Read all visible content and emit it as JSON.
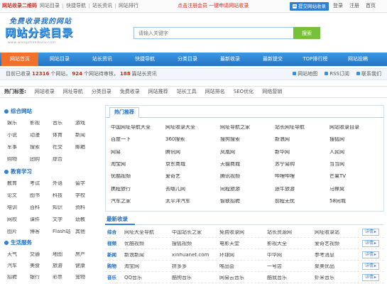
{
  "topbar": {
    "brand": "网站收录二维码",
    "links": [
      "网站目录",
      "快捷导航",
      "站长资讯",
      "网站排行"
    ],
    "notice": "点击注册会员 一键申请网站收录",
    "submit_label": "提交网站收录",
    "right_links": [
      "登录",
      "注册",
      "首页"
    ]
  },
  "header": {
    "logo_top": "免费收录我的网站",
    "logo_main": "网站分类目录",
    "logo_sub": "www.wangzhanmulu.com",
    "search": {
      "placeholder": "请输入关键字",
      "button": "搜索"
    }
  },
  "nav": {
    "items": [
      "网站首页",
      "网站目录",
      "站长资讯",
      "快捷导航",
      "分类目录",
      "最新收录",
      "最新提交",
      "TOP排行榜",
      "网站投稿"
    ]
  },
  "stats": {
    "prefix": "目前已收录",
    "n1": "12316",
    "t1": "个网站，",
    "n2": "924",
    "t2": "个网站待审核，",
    "n3": "188",
    "t3": "篇站长资讯",
    "right_links": [
      "网站地图",
      "RSS订阅",
      "联系我们"
    ]
  },
  "tags": {
    "label": "热门标签:",
    "items": [
      "网站收录",
      "网址导航",
      "分类目录",
      "免费收录",
      "网站推荐",
      "站长工具",
      "网站排名",
      "SEO优化",
      "网络营销"
    ]
  },
  "sidebar": {
    "groups": [
      {
        "title": "综合网站",
        "items": [
          "娱乐",
          "影视",
          "音乐",
          "游戏",
          "小说",
          "动漫",
          "体育",
          "新闻",
          "军事",
          "搜索",
          "社交",
          "邮箱",
          "购物",
          "团购",
          "综合"
        ]
      },
      {
        "title": "教育学习",
        "items": [
          "教育",
          "考试",
          "外语",
          "留学",
          "论文",
          "图书",
          "科技",
          "学校",
          "培训",
          "百科",
          "知识",
          "资料",
          "网校",
          "课件",
          "文学",
          "幼教",
          "图片",
          "博客",
          "Flash站",
          "其他"
        ]
      },
      {
        "title": "生活服务",
        "items": [
          "天气",
          "交通",
          "地图",
          "房产",
          "汽车",
          "美食",
          "旅游",
          "健康",
          "招聘",
          "银行",
          "彩票",
          "宠物"
        ]
      }
    ]
  },
  "hot": {
    "title": "热门推荐",
    "links": [
      "中国网址导航大全",
      "网址收录大全",
      "网址导航之家",
      "站长网址导航",
      "网站收录目录",
      "百度一下",
      "360搜索",
      "搜狗搜索",
      "新浪网",
      "搜狐网",
      "网易",
      "腾讯网",
      "凤凰网",
      "新华网",
      "人民网",
      "淘宝网",
      "京东商城",
      "天猫商城",
      "苏宁易购",
      "当当网",
      "优酷视频",
      "爱奇艺",
      "腾讯视频",
      "哔哩哔哩",
      "芒果TV",
      "携程旅行",
      "去哪儿网",
      "同程旅游",
      "途牛旅游",
      "马蜂窝",
      "汽车之家",
      "太平洋汽车",
      "智联招聘",
      "前程无忧",
      "58同城"
    ]
  },
  "latest": {
    "title": "最新收录",
    "rows": [
      {
        "category": "综合",
        "items": [
          "网址大全导航",
          "中国站长之家",
          "免费收录网",
          "站长资源网",
          "网址收录站"
        ],
        "more": "详情"
      },
      {
        "category": "视频",
        "items": [
          "优酷视频",
          "搜狐视频",
          "电影天堂",
          "影视大全",
          "爱奇艺视频"
        ],
        "more": "详情"
      },
      {
        "category": "新闻",
        "items": [
          "新浪新闻",
          "xinhuanet.com",
          "环球网",
          "中华网",
          "参考消息"
        ],
        "more": "详情"
      },
      {
        "category": "购物",
        "items": [
          "淘宝网",
          "拼多多",
          "唯品会",
          "一号店",
          "聚美优品"
        ],
        "more": "详情"
      },
      {
        "category": "音乐",
        "items": [
          "QQ音乐",
          "酷狗音乐",
          "网易云音乐",
          "酷我音乐",
          "虾米音乐"
        ],
        "more": "详情"
      }
    ]
  },
  "colors": {
    "primary_blue": "#2c7fd3",
    "nav_active_orange": "#f0702c",
    "search_button_green": "#76c03b",
    "highlight_red": "#e3231c"
  },
  "icons": [
    "upload-icon",
    "category-dot-icon",
    "link-square-icon"
  ]
}
